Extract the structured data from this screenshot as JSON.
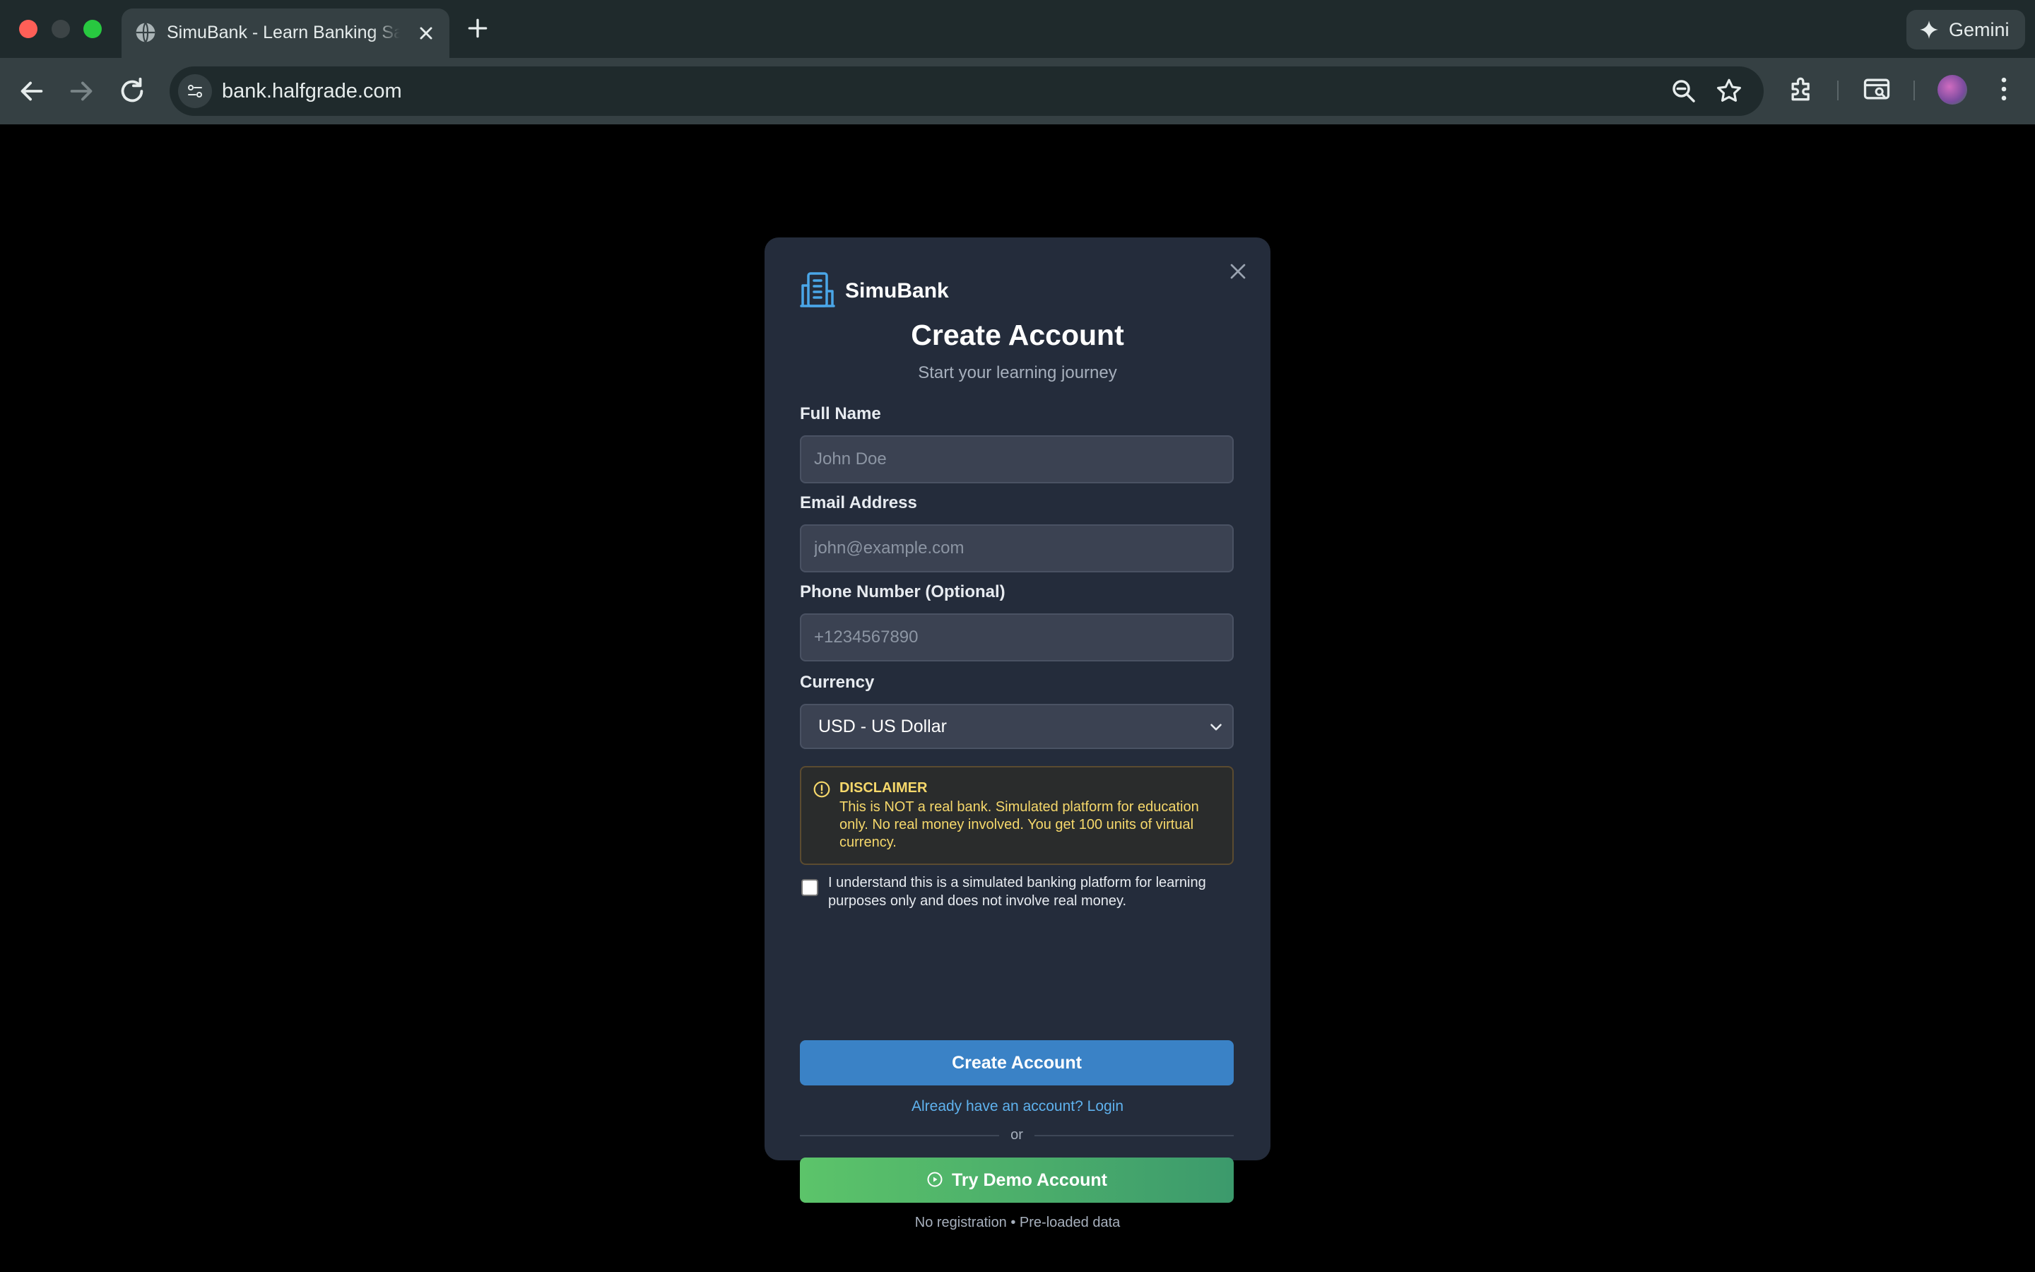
{
  "browser": {
    "tab_title": "SimuBank - Learn Banking Safely",
    "url": "bank.halfgrade.com",
    "gemini_label": "Gemini"
  },
  "app": {
    "brand": "SimuBank",
    "title": "Create Account",
    "subtitle": "Start your learning journey"
  },
  "form": {
    "full_name_label": "Full Name",
    "full_name_placeholder": "John Doe",
    "email_label": "Email Address",
    "email_placeholder": "john@example.com",
    "phone_label": "Phone Number (Optional)",
    "phone_placeholder": "+1234567890",
    "currency_label": "Currency",
    "currency_value": "USD - US Dollar"
  },
  "disclaimer": {
    "title": "DISCLAIMER",
    "text": "This is NOT a real bank. Simulated platform for education only. No real money involved. You get 100 units of virtual currency."
  },
  "agreement": {
    "checked": false,
    "text": "I understand this is a simulated banking platform for learning purposes only and does not involve real money."
  },
  "actions": {
    "create_label": "Create Account",
    "login_link": "Already have an account? Login",
    "or_text": "or",
    "demo_label": "Try Demo Account",
    "demo_note": "No registration • Pre-loaded data"
  },
  "colors": {
    "primary": "#3a82c6",
    "demo_start": "#5cc46a",
    "demo_end": "#3c9a6c",
    "warning_text": "#f6d86b",
    "link": "#5fb2ee"
  },
  "icons": [
    "globe-icon",
    "close-icon",
    "plus-icon",
    "sparkle-icon",
    "back-icon",
    "forward-icon",
    "reload-icon",
    "site-settings-icon",
    "zoom-icon",
    "star-icon",
    "extensions-icon",
    "tab-search-icon",
    "menu-icon",
    "bank-building-icon",
    "chevron-down-icon",
    "warning-icon",
    "play-icon"
  ]
}
